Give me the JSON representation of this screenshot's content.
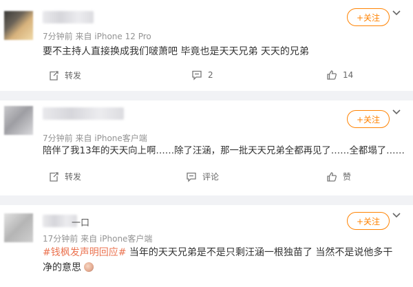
{
  "follow_label": "+关注",
  "posts": [
    {
      "name_visible": "",
      "meta_time": "7分钟前",
      "meta_source": "来自 iPhone 12 Pro",
      "content": "要不主持人直接换成我们啵萧吧  毕竟也是天天兄弟 天天的兄弟",
      "actions": {
        "repost": "转发",
        "comment": "2",
        "like": "14"
      }
    },
    {
      "name_visible": "",
      "meta_time": "7分钟前",
      "meta_source": "来自 iPhone客户端",
      "content": "陪伴了我13年的天天向上啊……除了汪涵，那一批天天兄弟全都再见了……全都塌了……",
      "actions": {
        "repost": "转发",
        "comment": "评论",
        "like": "赞"
      }
    },
    {
      "name_visible": "一口",
      "meta_time": "17分钟前",
      "meta_source": "来自 iPhone客户端",
      "topic": "#钱枫发声明回应#",
      "content": " 当年的天天兄弟是不是只剩汪涵一根独苗了 当然不是说他多干净的意思"
    }
  ]
}
